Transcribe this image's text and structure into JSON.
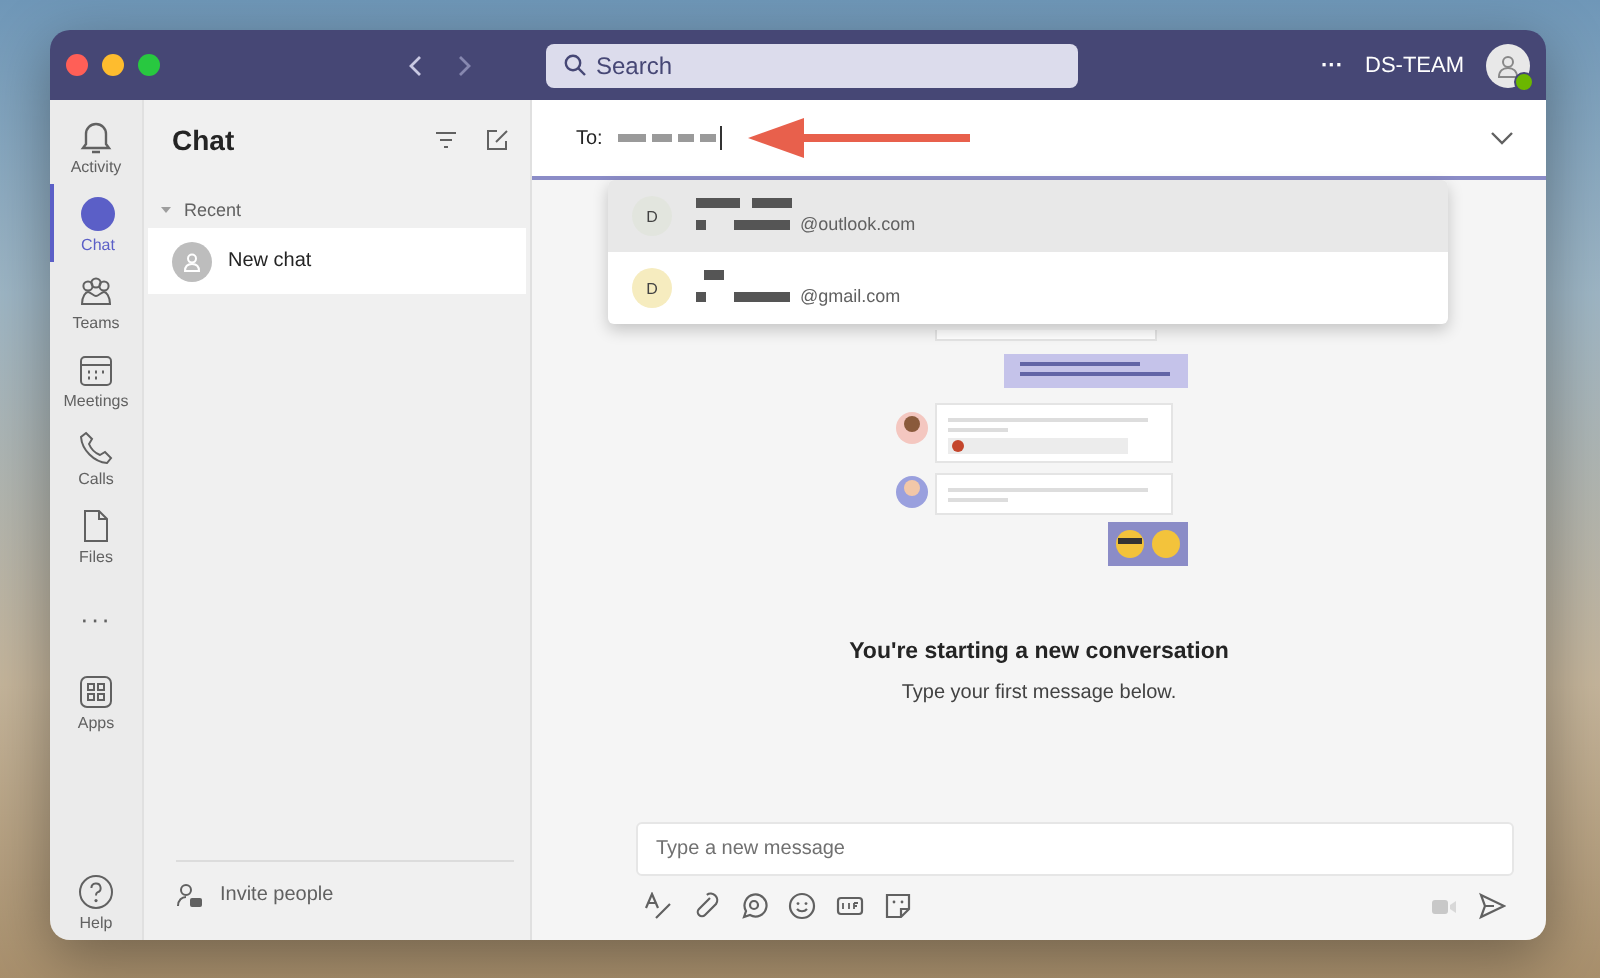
{
  "title_bar": {
    "search": {
      "placeholder": "Search"
    },
    "more": "···",
    "org": "DS-TEAM"
  },
  "rail": [
    {
      "kind": "app",
      "label": "Activity",
      "selected": false
    },
    {
      "kind": "app",
      "label": "Chat",
      "selected": true
    },
    {
      "kind": "app",
      "label": "Teams",
      "selected": false
    },
    {
      "kind": "app",
      "label": "Meetings",
      "selected": false
    },
    {
      "kind": "app",
      "label": "Calls",
      "selected": false
    },
    {
      "kind": "app",
      "label": "Files",
      "selected": false
    },
    {
      "kind": "more",
      "label": "···"
    },
    {
      "kind": "app",
      "label": "Apps",
      "selected": false
    },
    {
      "kind": "help",
      "label": "Help",
      "selected": false
    }
  ],
  "chat_list": {
    "title": "Chat",
    "section": {
      "label": "Recent",
      "expanded": true
    },
    "items": [
      {
        "label": "New chat",
        "selected": true
      }
    ],
    "invite": "Invite people"
  },
  "compose": {
    "to_label": "To:"
  },
  "suggestions": [
    {
      "initial": "D",
      "email_domain": "@outlook.com",
      "selected": true,
      "color": "#e2e5de"
    },
    {
      "initial": "D",
      "email_domain": "@gmail.com",
      "selected": false,
      "color": "#f6ecbf"
    }
  ],
  "empty_state": {
    "title": "You're starting a new conversation",
    "subtitle": "Type your first message below."
  },
  "composer": {
    "placeholder": "Type a new message"
  }
}
